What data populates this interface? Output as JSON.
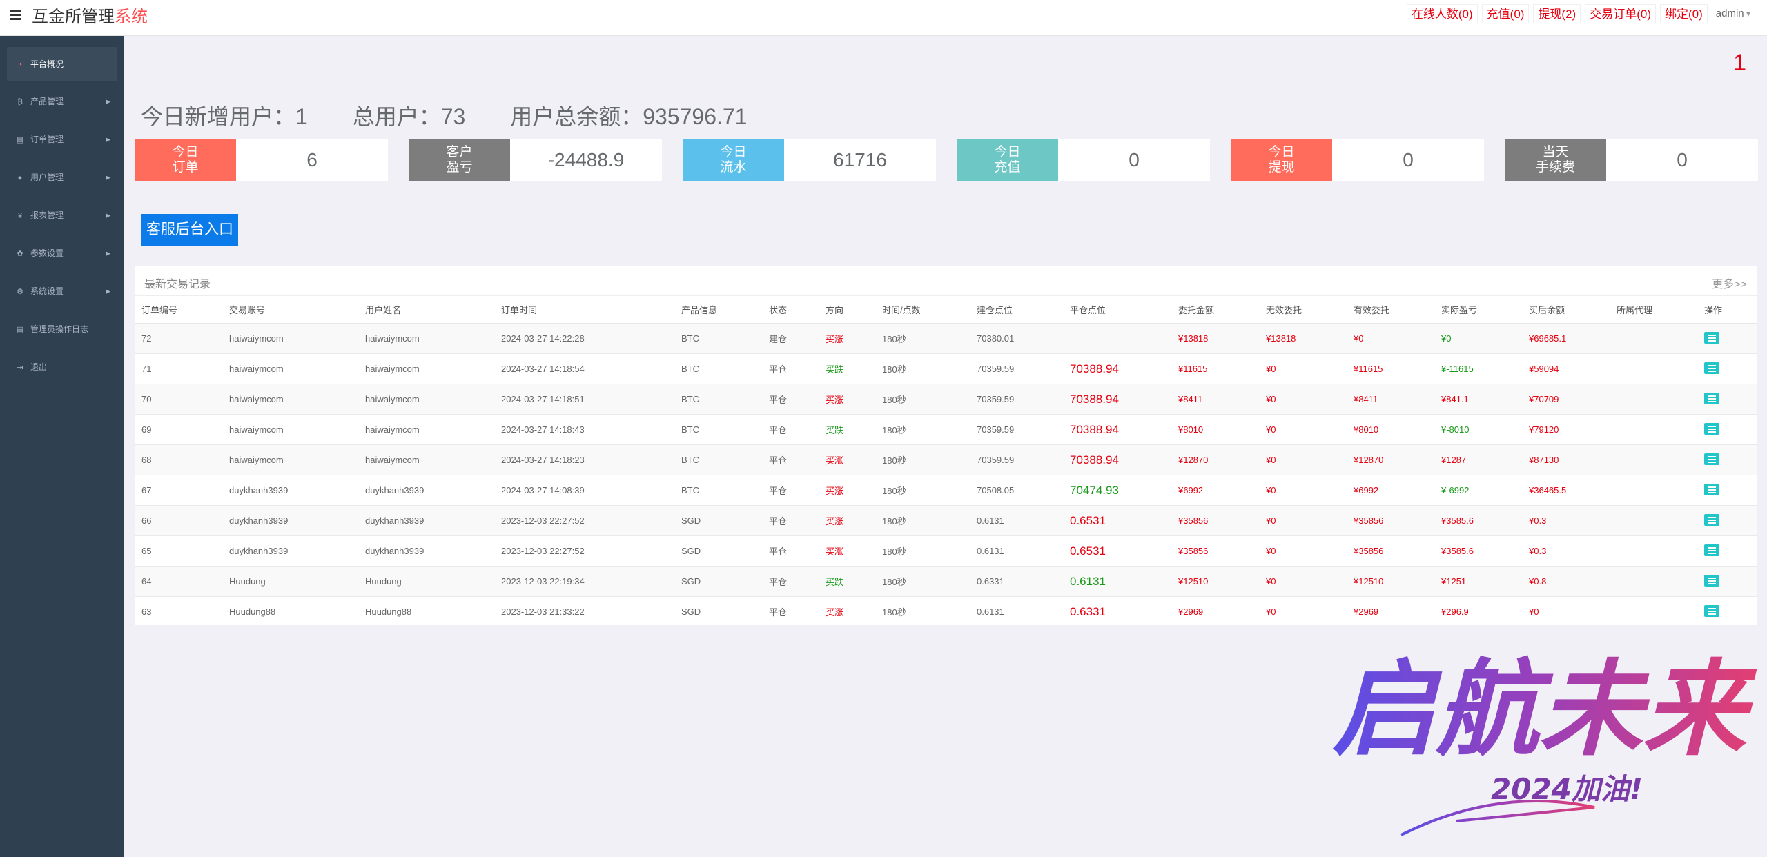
{
  "header": {
    "brand_main": "互金所管理",
    "brand_accent": "系统",
    "links": [
      "在线人数(0)",
      "充值(0)",
      "提现(2)",
      "交易订单(0)",
      "绑定(0)"
    ],
    "user": "admin"
  },
  "sidebar": {
    "items": [
      {
        "label": "平台概况",
        "icon": "dashboard-icon"
      },
      {
        "label": "产品管理",
        "icon": "bitcoin-icon"
      },
      {
        "label": "订单管理",
        "icon": "clipboard-icon"
      },
      {
        "label": "用户管理",
        "icon": "user-icon"
      },
      {
        "label": "报表管理",
        "icon": "yen-icon"
      },
      {
        "label": "参数设置",
        "icon": "gear-icon"
      },
      {
        "label": "系统设置",
        "icon": "gears-icon"
      },
      {
        "label": "管理员操作日志",
        "icon": "clipboard-icon"
      },
      {
        "label": "退出",
        "icon": "logout-icon"
      }
    ]
  },
  "page_number": "1",
  "summary": {
    "today_new_users": "今日新增用户：1",
    "total_users": "总用户：73",
    "total_balance": "用户总余额：935796.71"
  },
  "stats": [
    {
      "label": "今日\n订单",
      "value": "6",
      "color": "#ff6c5c"
    },
    {
      "label": "客户\n盈亏",
      "value": "-24488.9",
      "color": "#7d7d7d"
    },
    {
      "label": "今日\n流水",
      "value": "61716",
      "color": "#5bc0eb"
    },
    {
      "label": "今日\n充值",
      "value": "0",
      "color": "#6cc7c5"
    },
    {
      "label": "今日\n提现",
      "value": "0",
      "color": "#ff6c5c"
    },
    {
      "label": "当天\n手续费",
      "value": "0",
      "color": "#7d7d7d"
    }
  ],
  "cs_button": "客服后台入口",
  "panel": {
    "title": "最新交易记录",
    "more": "更多>>",
    "columns": [
      "订单编号",
      "交易账号",
      "用户姓名",
      "订单时间",
      "产品信息",
      "状态",
      "方向",
      "时间/点数",
      "建仓点位",
      "平仓点位",
      "委托金额",
      "无效委托",
      "有效委托",
      "实际盈亏",
      "买后余额",
      "所属代理",
      "操作"
    ],
    "rows": [
      [
        "72",
        "haiwaiymcom",
        "haiwaiymcom",
        "2024-03-27 14:22:28",
        "BTC",
        "建仓",
        "买涨",
        "180秒",
        "70380.01",
        "",
        "¥13818",
        "¥13818",
        "¥0",
        "¥0",
        "¥69685.1",
        ""
      ],
      [
        "71",
        "haiwaiymcom",
        "haiwaiymcom",
        "2024-03-27 14:18:54",
        "BTC",
        "平仓",
        "买跌",
        "180秒",
        "70359.59",
        "70388.94",
        "¥11615",
        "¥0",
        "¥11615",
        "¥-11615",
        "¥59094",
        ""
      ],
      [
        "70",
        "haiwaiymcom",
        "haiwaiymcom",
        "2024-03-27 14:18:51",
        "BTC",
        "平仓",
        "买涨",
        "180秒",
        "70359.59",
        "70388.94",
        "¥8411",
        "¥0",
        "¥8411",
        "¥841.1",
        "¥70709",
        ""
      ],
      [
        "69",
        "haiwaiymcom",
        "haiwaiymcom",
        "2024-03-27 14:18:43",
        "BTC",
        "平仓",
        "买跌",
        "180秒",
        "70359.59",
        "70388.94",
        "¥8010",
        "¥0",
        "¥8010",
        "¥-8010",
        "¥79120",
        ""
      ],
      [
        "68",
        "haiwaiymcom",
        "haiwaiymcom",
        "2024-03-27 14:18:23",
        "BTC",
        "平仓",
        "买涨",
        "180秒",
        "70359.59",
        "70388.94",
        "¥12870",
        "¥0",
        "¥12870",
        "¥1287",
        "¥87130",
        ""
      ],
      [
        "67",
        "duykhanh3939",
        "duykhanh3939",
        "2024-03-27 14:08:39",
        "BTC",
        "平仓",
        "买涨",
        "180秒",
        "70508.05",
        "70474.93",
        "¥6992",
        "¥0",
        "¥6992",
        "¥-6992",
        "¥36465.5",
        ""
      ],
      [
        "66",
        "duykhanh3939",
        "duykhanh3939",
        "2023-12-03 22:27:52",
        "SGD",
        "平仓",
        "买涨",
        "180秒",
        "0.6131",
        "0.6531",
        "¥35856",
        "¥0",
        "¥35856",
        "¥3585.6",
        "¥0.3",
        ""
      ],
      [
        "65",
        "duykhanh3939",
        "duykhanh3939",
        "2023-12-03 22:27:52",
        "SGD",
        "平仓",
        "买涨",
        "180秒",
        "0.6131",
        "0.6531",
        "¥35856",
        "¥0",
        "¥35856",
        "¥3585.6",
        "¥0.3",
        ""
      ],
      [
        "64",
        "Huudung",
        "Huudung",
        "2023-12-03 22:19:34",
        "SGD",
        "平仓",
        "买跌",
        "180秒",
        "0.6331",
        "0.6131",
        "¥12510",
        "¥0",
        "¥12510",
        "¥1251",
        "¥0.8",
        ""
      ],
      [
        "63",
        "Huudung88",
        "Huudung88",
        "2023-12-03 21:33:22",
        "SGD",
        "平仓",
        "买涨",
        "180秒",
        "0.6131",
        "0.6331",
        "¥2969",
        "¥0",
        "¥2969",
        "¥296.9",
        "¥0",
        ""
      ]
    ]
  },
  "watermark": {
    "text_main": "启航未来",
    "text_sub": "2024加油!"
  },
  "colors": {
    "red": "#e6000f",
    "green": "#1a9a1a",
    "sidebar": "#2f4050"
  }
}
